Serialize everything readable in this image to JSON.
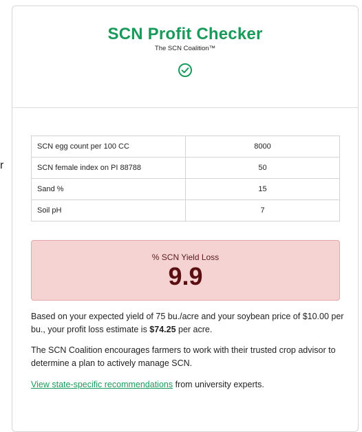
{
  "stray_char": "r",
  "header": {
    "title": "SCN Profit Checker",
    "subtitle": "The SCN Coalition™",
    "status_icon": "check-circle-icon",
    "brand_color": "#1a9a5a"
  },
  "inputs": [
    {
      "label": "SCN egg count per 100 CC",
      "value": "8000"
    },
    {
      "label": "SCN female index on PI 88788",
      "value": "50"
    },
    {
      "label": "Sand %",
      "value": "15"
    },
    {
      "label": "Soil pH",
      "value": "7"
    }
  ],
  "result": {
    "label": "% SCN Yield Loss",
    "value": "9.9",
    "bg_color": "#f5d3d3"
  },
  "summary": {
    "part1": "Based on your expected yield of 75 bu./acre and your soybean price of $10.00 per bu., your profit loss estimate is ",
    "amount": "$74.25",
    "part2": " per acre."
  },
  "advice": "The SCN Coalition encourages farmers to work with their trusted crop advisor to determine a plan to actively manage SCN.",
  "recommendation": {
    "link_text": "View state-specific recommendations",
    "rest": " from university experts."
  }
}
